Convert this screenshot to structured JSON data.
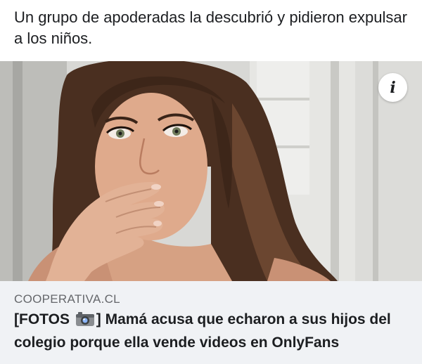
{
  "post": {
    "text": "Un grupo de apoderadas la descubrió y pidieron expulsar a los niños."
  },
  "info_button": {
    "label": "i"
  },
  "link_preview": {
    "domain": "COOPERATIVA.CL",
    "headline_prefix": "[FOTOS",
    "headline_icon": "camera-icon",
    "headline_rest": "] Mamá acusa que echaron a sus hijos del colegio porque ella vende videos en OnlyFans"
  },
  "colors": {
    "card_background": "#f0f2f5",
    "domain_text": "#65676b",
    "headline_text": "#1c1e21"
  }
}
